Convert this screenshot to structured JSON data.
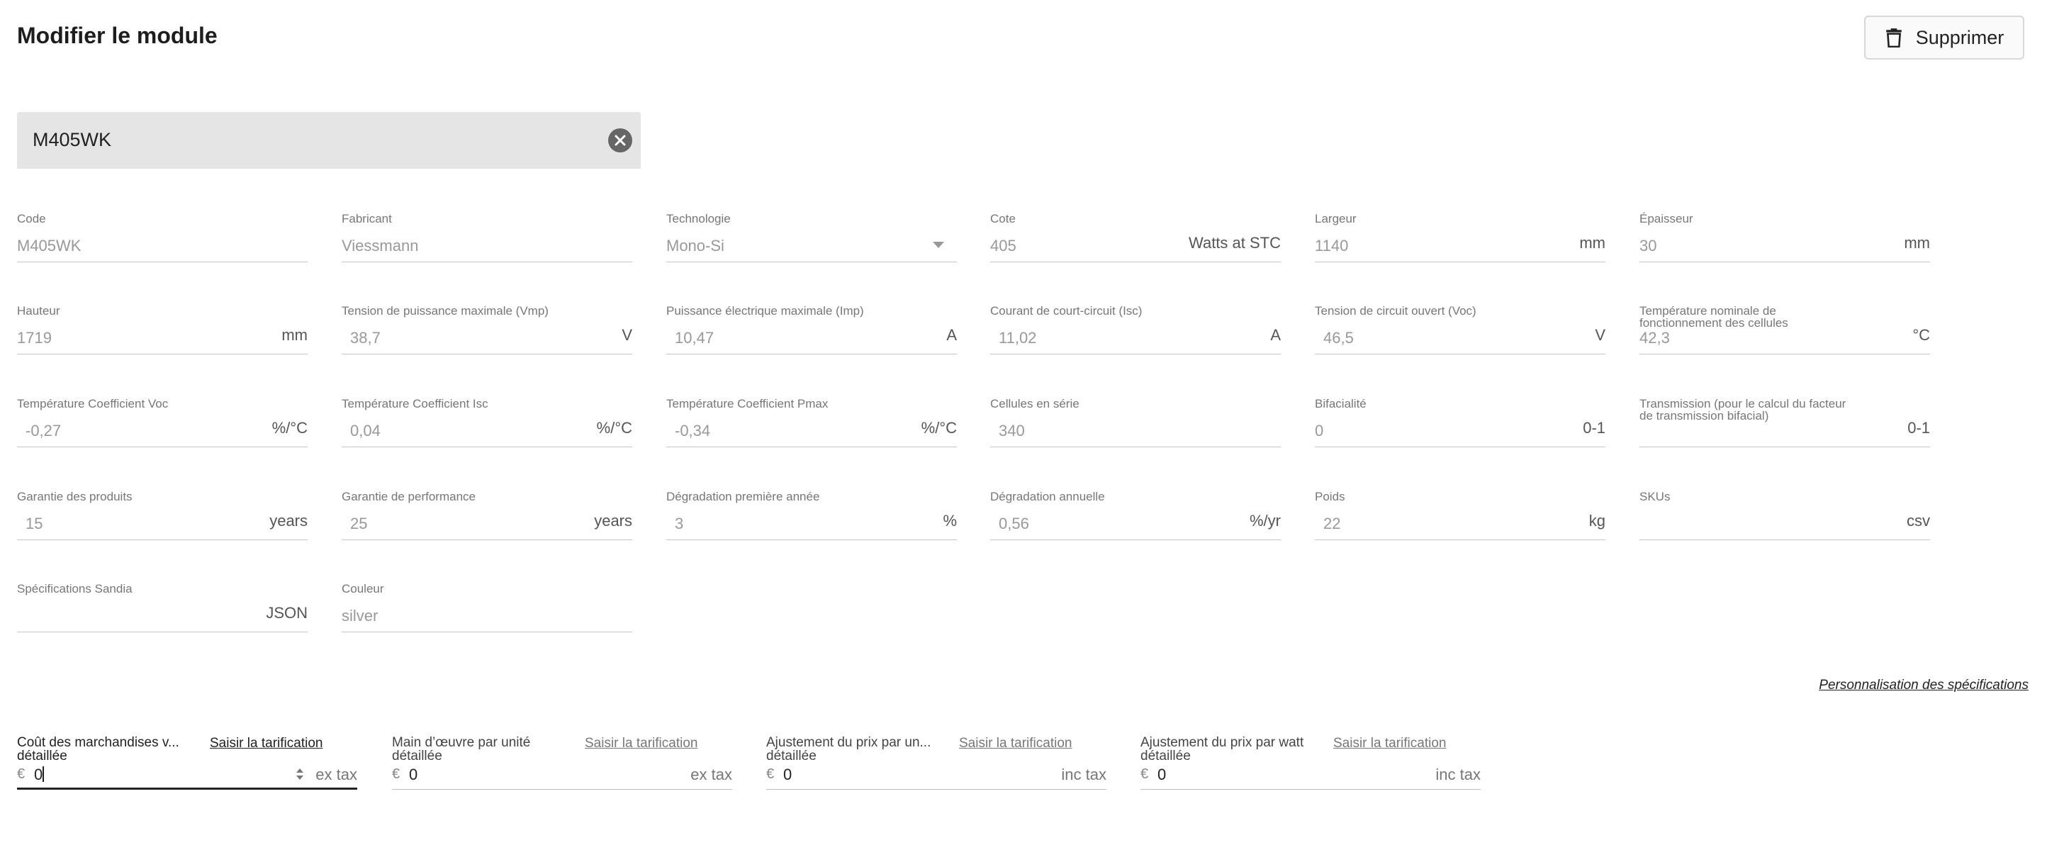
{
  "header": {
    "title": "Modifier le module",
    "delete_label": "Supprimer"
  },
  "name_field": {
    "value": "M405WK"
  },
  "fields": [
    {
      "label": "Code",
      "value": "M405WK",
      "unit": ""
    },
    {
      "label": "Fabricant",
      "value": "Viessmann",
      "unit": ""
    },
    {
      "label": "Technologie",
      "value": "Mono-Si",
      "unit": ""
    },
    {
      "label": "Cote",
      "value": "405",
      "unit": "Watts at STC"
    },
    {
      "label": "Largeur",
      "value": "1140",
      "unit": "mm"
    },
    {
      "label": "Épaisseur",
      "value": "30",
      "unit": "mm"
    },
    {
      "label": "Hauteur",
      "value": "1719",
      "unit": "mm"
    },
    {
      "label": "Tension de puissance maximale (Vmp)",
      "value": "38,7",
      "unit": "V"
    },
    {
      "label": "Puissance électrique maximale (Imp)",
      "value": "10,47",
      "unit": "A"
    },
    {
      "label": "Courant de court-circuit (Isc)",
      "value": "11,02",
      "unit": "A"
    },
    {
      "label": "Tension de circuit ouvert (Voc)",
      "value": "46,5",
      "unit": "V"
    },
    {
      "label": "Température nominale de",
      "label2": "fonctionnement des cellules",
      "value": "42,3",
      "unit": "°C"
    },
    {
      "label": "Température Coefficient Voc",
      "value": "-0,27",
      "unit": "%/°C"
    },
    {
      "label": "Température Coefficient Isc",
      "value": "0,04",
      "unit": "%/°C"
    },
    {
      "label": "Température Coefficient Pmax",
      "value": "-0,34",
      "unit": "%/°C"
    },
    {
      "label": "Cellules en série",
      "value": "340",
      "unit": ""
    },
    {
      "label": "Bifacialité",
      "value": "0",
      "unit": "0-1"
    },
    {
      "label": "Transmission (pour le calcul du facteur",
      "label2": "de transmission bifacial)",
      "value": "",
      "unit": "0-1"
    },
    {
      "label": "Garantie des produits",
      "value": "15",
      "unit": "years"
    },
    {
      "label": "Garantie de performance",
      "value": "25",
      "unit": "years"
    },
    {
      "label": "Dégradation première année",
      "value": "3",
      "unit": "%"
    },
    {
      "label": "Dégradation annuelle",
      "value": "0,56",
      "unit": "%/yr"
    },
    {
      "label": "Poids",
      "value": "22",
      "unit": "kg"
    },
    {
      "label": "SKUs",
      "value": "",
      "unit": "csv"
    },
    {
      "label": "Spécifications Sandia",
      "value": "",
      "unit": "JSON"
    },
    {
      "label": "Couleur",
      "value": "silver",
      "unit": ""
    }
  ],
  "custom_specs_link": "Personnalisation des spécifications",
  "pricing": [
    {
      "label": "Coût des marchandises v...",
      "label2": "détaillée",
      "link": "Saisir la tarification",
      "currency": "€",
      "value": "0",
      "tax": "ex tax"
    },
    {
      "label": "Main d’œuvre par unité",
      "label2": "détaillée",
      "link": "Saisir la tarification",
      "currency": "€",
      "value": "0",
      "tax": "ex tax"
    },
    {
      "label": "Ajustement du prix par un...",
      "label2": "détaillée",
      "link": "Saisir la tarification",
      "currency": "€",
      "value": "0",
      "tax": "inc tax"
    },
    {
      "label": "Ajustement du prix par watt",
      "label2": "détaillée",
      "link": "Saisir la tarification",
      "currency": "€",
      "value": "0",
      "tax": "inc tax"
    }
  ]
}
